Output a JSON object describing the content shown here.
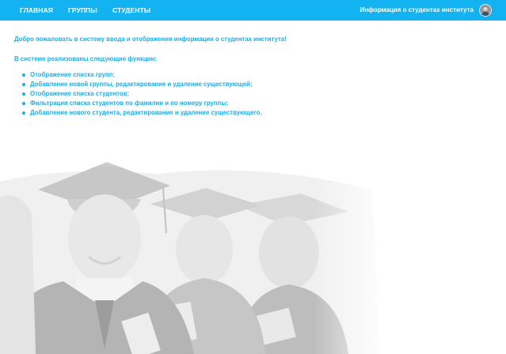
{
  "navbar": {
    "items": [
      {
        "label": "ГЛАВНАЯ"
      },
      {
        "label": "ГРУППЫ"
      },
      {
        "label": "СТУДЕНТЫ"
      }
    ],
    "site_title": "Информация о студентах института",
    "accent_color": "#13b2f0"
  },
  "main": {
    "welcome": "Добро пожаловать в систему ввода и отображения информации о студентах института!",
    "functions_title": "В системе реализованы следующие функции:",
    "features": [
      "Отображение списка групп;",
      "Добавление новой группы, редактирование и удаление существующей;",
      "Отображение списка студентов;",
      "Фильтрация списка студентов по фамилии и по номеру группы;",
      "Добавление нового студента, редактирование и удаление существующего."
    ],
    "text_color": "#19aee8"
  }
}
